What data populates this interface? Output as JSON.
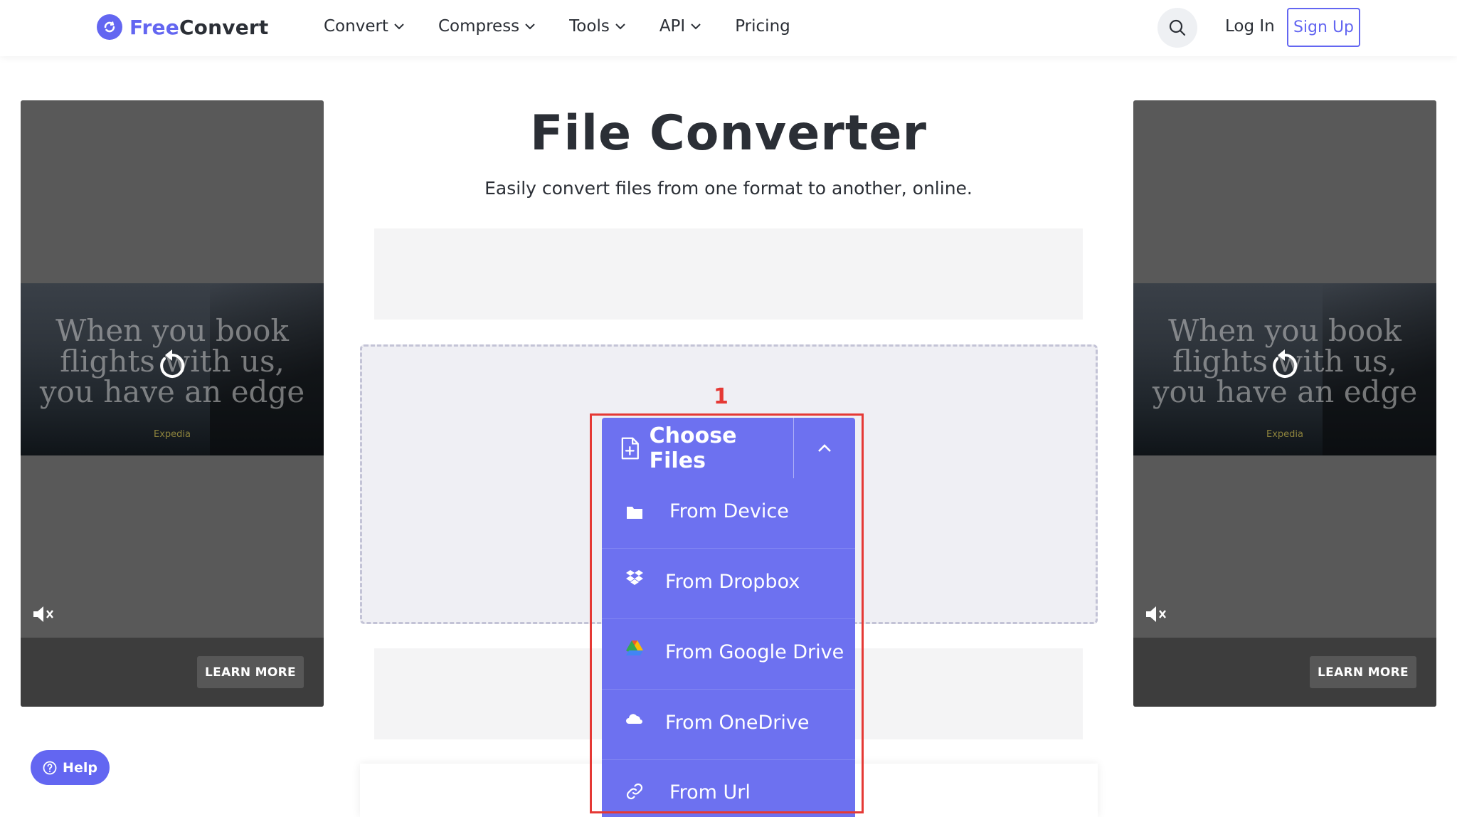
{
  "header": {
    "logo": {
      "free": "Free",
      "convert": "Convert"
    },
    "nav": [
      {
        "label": "Convert",
        "has_dropdown": true
      },
      {
        "label": "Compress",
        "has_dropdown": true
      },
      {
        "label": "Tools",
        "has_dropdown": true
      },
      {
        "label": "API",
        "has_dropdown": true
      },
      {
        "label": "Pricing",
        "has_dropdown": false
      }
    ],
    "search_icon": "search-icon",
    "login_label": "Log In",
    "signup_label": "Sign Up"
  },
  "main": {
    "title": "File Converter",
    "subtitle": "Easily convert files from one format to another, online.",
    "choose_files_label": "Choose Files",
    "menu": [
      {
        "label": "From Device",
        "icon": "folder-icon"
      },
      {
        "label": "From Dropbox",
        "icon": "dropbox-icon"
      },
      {
        "label": "From Google Drive",
        "icon": "google-drive-icon"
      },
      {
        "label": "From OneDrive",
        "icon": "onedrive-icon"
      },
      {
        "label": "From Url",
        "icon": "link-icon"
      }
    ]
  },
  "ads": {
    "headline_line1": "When you book",
    "headline_line2": "flights with us,",
    "headline_line3": "you have an edge",
    "brand": "Expedia",
    "cta": "LEARN MORE"
  },
  "annotation": {
    "number": "1"
  },
  "help_label": "Help",
  "colors": {
    "accent": "#6366f1",
    "menu": "#6d71f0",
    "annotation": "#e53935"
  }
}
